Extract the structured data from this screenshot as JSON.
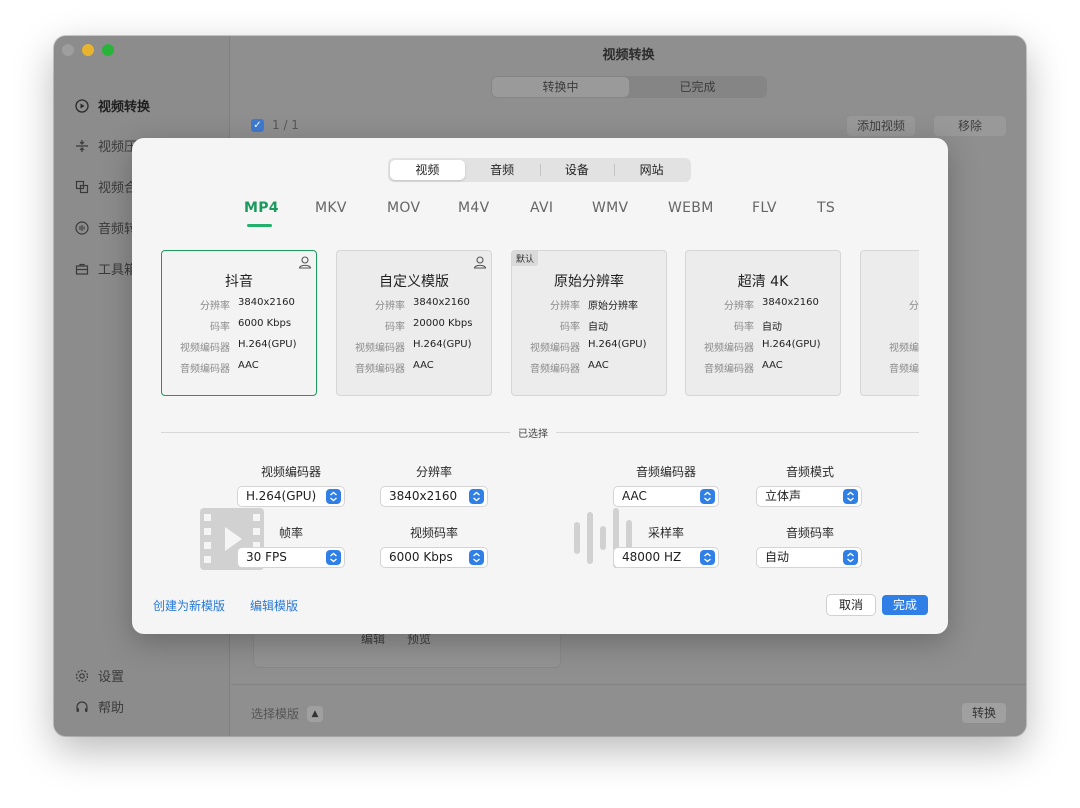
{
  "window": {
    "title": "视频转换",
    "tabs": [
      {
        "label": "转换中",
        "selected": true
      },
      {
        "label": "已完成",
        "selected": false
      }
    ],
    "select_all": "1 / 1",
    "add_video": "添加视频",
    "remove": "移除",
    "behind_edit": "编辑",
    "behind_preview": "预览",
    "template_select": "选择模版",
    "convert": "转换"
  },
  "sidebar": {
    "items": [
      {
        "label": "视频转换",
        "icon": "play-circle-icon",
        "active": true
      },
      {
        "label": "视频压",
        "icon": "compress-icon",
        "active": false
      },
      {
        "label": "视频合",
        "icon": "merge-icon",
        "active": false
      },
      {
        "label": "音频转",
        "icon": "audio-icon",
        "active": false
      },
      {
        "label": "工具箱",
        "icon": "toolbox-icon",
        "active": false
      }
    ],
    "bottom": [
      {
        "label": "设置",
        "icon": "gear-icon"
      },
      {
        "label": "帮助",
        "icon": "help-icon"
      }
    ]
  },
  "dialog": {
    "categories": [
      "视频",
      "音频",
      "设备",
      "网站"
    ],
    "selected_category": "视频",
    "formats": [
      "MP4",
      "MKV",
      "MOV",
      "M4V",
      "AVI",
      "WMV",
      "WEBM",
      "FLV",
      "TS"
    ],
    "selected_format": "MP4",
    "presets": [
      {
        "title": "抖音",
        "badge": "",
        "user": true,
        "selected": true,
        "rows": [
          {
            "k": "分辨率",
            "v": "3840x2160"
          },
          {
            "k": "码率",
            "v": "6000 Kbps"
          },
          {
            "k": "视频编码器",
            "v": "H.264(GPU)"
          },
          {
            "k": "音频编码器",
            "v": "AAC"
          }
        ]
      },
      {
        "title": "自定义模版",
        "badge": "",
        "user": true,
        "selected": false,
        "rows": [
          {
            "k": "分辨率",
            "v": "3840x2160"
          },
          {
            "k": "码率",
            "v": "20000 Kbps"
          },
          {
            "k": "视频编码器",
            "v": "H.264(GPU)"
          },
          {
            "k": "音频编码器",
            "v": "AAC"
          }
        ]
      },
      {
        "title": "原始分辨率",
        "badge": "默认",
        "user": false,
        "selected": false,
        "rows": [
          {
            "k": "分辨率",
            "v": "原始分辨率"
          },
          {
            "k": "码率",
            "v": "自动"
          },
          {
            "k": "视频编码器",
            "v": "H.264(GPU)"
          },
          {
            "k": "音频编码器",
            "v": "AAC"
          }
        ]
      },
      {
        "title": "超清 4K",
        "badge": "",
        "user": false,
        "selected": false,
        "rows": [
          {
            "k": "分辨率",
            "v": "3840x2160"
          },
          {
            "k": "码率",
            "v": "自动"
          },
          {
            "k": "视频编码器",
            "v": "H.264(GPU)"
          },
          {
            "k": "音频编码器",
            "v": "AAC"
          }
        ]
      },
      {
        "title": "超",
        "badge": "",
        "user": false,
        "selected": false,
        "rows": [
          {
            "k": "分辨",
            "v": ""
          },
          {
            "k": "码",
            "v": ""
          },
          {
            "k": "视频编码",
            "v": ""
          },
          {
            "k": "音频编码",
            "v": ""
          }
        ]
      }
    ],
    "selected_label": "已选择",
    "video": {
      "encoder_label": "视频编码器",
      "encoder_value": "H.264(GPU)",
      "resolution_label": "分辨率",
      "resolution_value": "3840x2160",
      "framerate_label": "帧率",
      "framerate_value": "30 FPS",
      "bitrate_label": "视频码率",
      "bitrate_value": "6000 Kbps"
    },
    "audio": {
      "encoder_label": "音频编码器",
      "encoder_value": "AAC",
      "mode_label": "音频模式",
      "mode_value": "立体声",
      "samplerate_label": "采样率",
      "samplerate_value": "48000 HZ",
      "bitrate_label": "音频码率",
      "bitrate_value": "自动"
    },
    "create_template": "创建为新模版",
    "edit_template": "编辑模版",
    "cancel": "取消",
    "done": "完成",
    "accent_color": "#2f7fe6",
    "selected_color": "#1c9a5e"
  }
}
